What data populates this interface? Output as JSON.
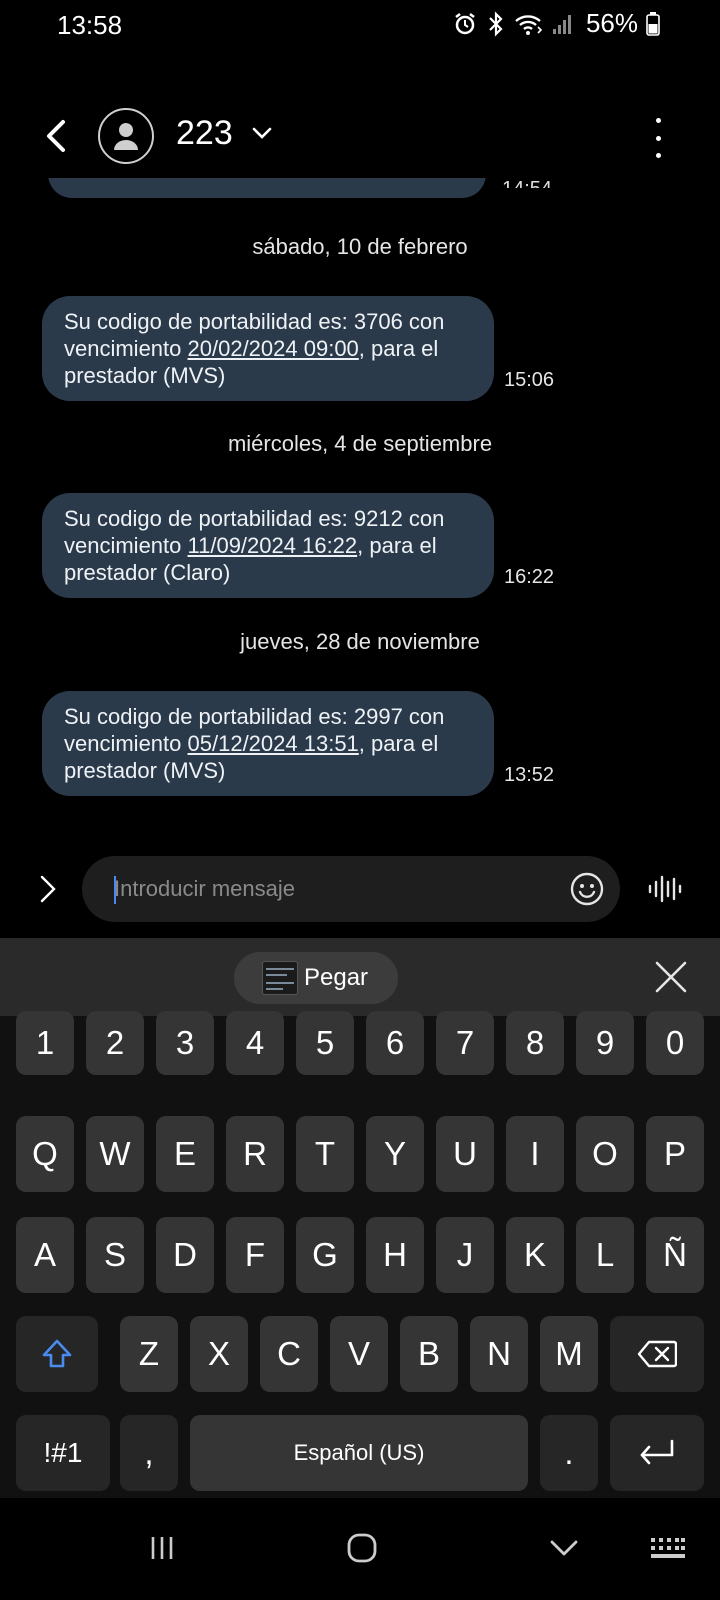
{
  "status_bar": {
    "time": "13:58",
    "battery": "56%",
    "icons": [
      "alarm-icon",
      "bluetooth-icon",
      "wifi-icon",
      "signal-icon",
      "battery-icon"
    ]
  },
  "header": {
    "contact_name": "223",
    "icons": [
      "back-icon",
      "avatar-icon",
      "chevron-down-icon",
      "more-options-icon"
    ]
  },
  "conversation": {
    "partial_time": "14:54",
    "groups": [
      {
        "date": "sábado, 10 de febrero",
        "text_before": "Su codigo de portabilidad es: 3706 con vencimiento ",
        "link": "20/02/2024 09:00",
        "text_after": ", para el prestador (MVS)",
        "time": "15:06"
      },
      {
        "date": "miércoles, 4 de septiembre",
        "text_before": "Su codigo de portabilidad es: 9212 con vencimiento ",
        "link": "11/09/2024 16:22",
        "text_after": ", para el prestador (Claro)",
        "time": "16:22"
      },
      {
        "date": "jueves, 28 de noviembre",
        "text_before": "Su codigo de portabilidad es: 2997 con vencimiento ",
        "link": "05/12/2024 13:51",
        "text_after": ", para el prestador (MVS)",
        "time": "13:52"
      }
    ]
  },
  "composer": {
    "placeholder": "Introducir mensaje",
    "value": ""
  },
  "keyboard": {
    "paste_label": "Pegar",
    "number_row": [
      "1",
      "2",
      "3",
      "4",
      "5",
      "6",
      "7",
      "8",
      "9",
      "0"
    ],
    "row1": [
      "Q",
      "W",
      "E",
      "R",
      "T",
      "Y",
      "U",
      "I",
      "O",
      "P"
    ],
    "row2": [
      "A",
      "S",
      "D",
      "F",
      "G",
      "H",
      "J",
      "K",
      "L",
      "Ñ"
    ],
    "row3": [
      "Z",
      "X",
      "C",
      "V",
      "B",
      "N",
      "M"
    ],
    "symbols_label": "!#1",
    "comma": ",",
    "space_label": "Español (US)",
    "period": ".",
    "accent_color": "#4a8bf0"
  },
  "nav_bar": {
    "icons": [
      "recents-icon",
      "home-icon",
      "hide-keyboard-icon",
      "keyboard-switch-icon"
    ]
  }
}
